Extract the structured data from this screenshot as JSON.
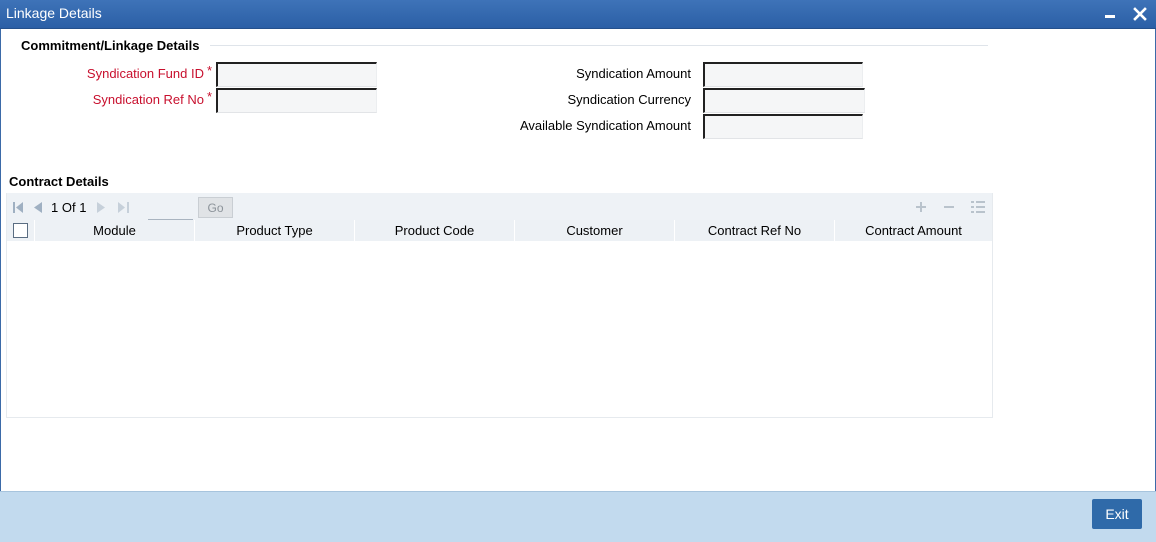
{
  "window": {
    "title": "Linkage Details",
    "minimize_icon": "minimize-icon",
    "close_icon": "close-icon"
  },
  "linkage_section": {
    "title": "Commitment/Linkage Details",
    "fields": {
      "syndication_fund_id": {
        "label": "Syndication Fund ID",
        "required_mark": "*",
        "value": ""
      },
      "syndication_ref_no": {
        "label": "Syndication Ref No",
        "required_mark": "*",
        "value": ""
      },
      "syndication_amount": {
        "label": "Syndication Amount",
        "value": ""
      },
      "syndication_currency": {
        "label": "Syndication Currency",
        "value": ""
      },
      "available_syndication_amount": {
        "label": "Available Syndication Amount",
        "value": ""
      }
    }
  },
  "contract_section": {
    "title": "Contract Details",
    "pager": {
      "current": "1",
      "of_label": "Of",
      "total": "1",
      "page_input": "",
      "go_label": "Go"
    },
    "toolbar_icons": [
      "add-row-icon",
      "delete-row-icon",
      "single-view-icon"
    ],
    "columns": [
      "Module",
      "Product Type",
      "Product Code",
      "Customer",
      "Contract Ref No",
      "Contract Amount"
    ],
    "rows": []
  },
  "footer": {
    "exit_label": "Exit"
  },
  "colors": {
    "titlebar": "#2f64ab",
    "required_label": "#c8102e",
    "footer": "#c2daee",
    "exit_button": "#2f6aa9"
  }
}
